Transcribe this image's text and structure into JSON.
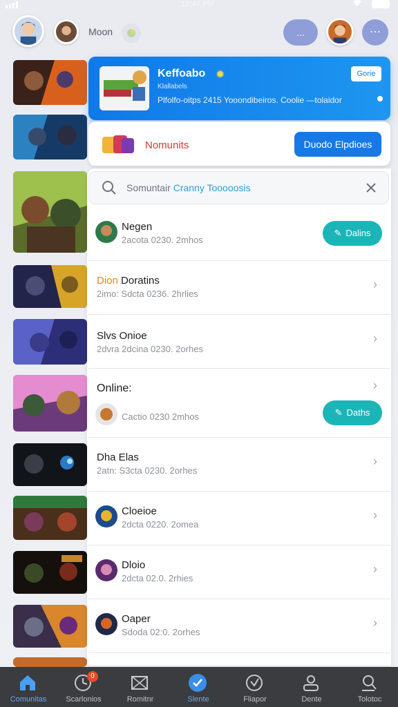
{
  "status_bar": {
    "time": "12:47 PM"
  },
  "topbar": {
    "label": "Moon",
    "pill_label": "...",
    "round_label": "⋯"
  },
  "promo": {
    "title": "Keffoabo",
    "subtitle": "Klallabels",
    "description": "Plfolfo-oitps 2415 Yooondibeiros. Coolie —tolaidor",
    "button": "Gorie"
  },
  "nom_card": {
    "label": "Nomunits",
    "button": "Duodo Elpdioes"
  },
  "search": {
    "placeholder_gray": "Somuntair",
    "placeholder_blue": "Cranny Tooooosis"
  },
  "rows": [
    {
      "title": "Negen",
      "sub": "2acota 0230. 2mhos",
      "action": "Dalins"
    },
    {
      "title_accent": "Dion",
      "title_rest": " Doratins",
      "sub": "2imo: Sdcta 0236. 2hrlies"
    },
    {
      "title": "Slvs Onioe",
      "sub": "2dvra 2dcina 0230. 2orhes"
    },
    {
      "title": "Online:",
      "sub": "Cactio 0230 2mhos",
      "action": "Daths"
    },
    {
      "title": "Dha Elas",
      "sub": "2atn: S3cta 0230. 2orhes"
    },
    {
      "title": "Cloeioe",
      "sub": "2dcta 0220. 2omea"
    },
    {
      "title": "Dloio",
      "sub": "2dcta 02.0. 2rhies"
    },
    {
      "title": "Oaper",
      "sub": "Sdoda 02:0. 2orhes"
    }
  ],
  "bottom_nav": [
    {
      "label": "Comunitas",
      "icon": "home-icon",
      "active": true
    },
    {
      "label": "Scarlonios",
      "icon": "clock-icon",
      "badge": "0"
    },
    {
      "label": "Romitnr",
      "icon": "map-icon"
    },
    {
      "label": "Slente",
      "icon": "check-badge-icon",
      "active": true
    },
    {
      "label": "Fliapor",
      "icon": "compass-icon"
    },
    {
      "label": "Dente",
      "icon": "profile-icon"
    },
    {
      "label": "Tolotoc",
      "icon": "search-person-icon"
    }
  ],
  "colors": {
    "accent_blue": "#1679e6",
    "teal": "#1bb5b8",
    "nav_bg": "#3a3c40",
    "alert_red": "#d23b2f"
  }
}
